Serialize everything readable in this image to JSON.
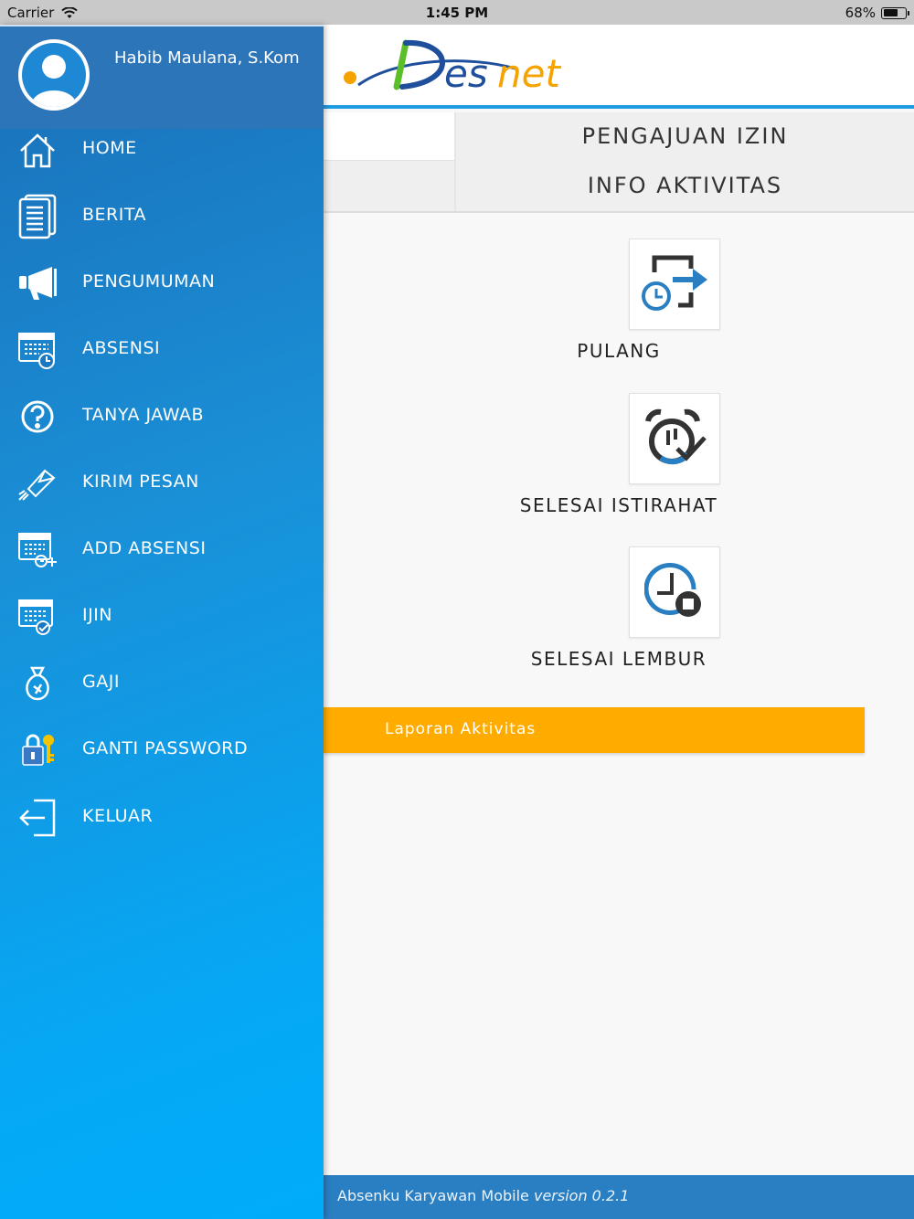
{
  "status_bar": {
    "carrier": "Carrier",
    "time": "1:45 PM",
    "battery": "68%",
    "battery_level": 0.68
  },
  "drawer": {
    "user_name": "Habib Maulana, S.Kom",
    "items": [
      {
        "label": "HOME",
        "icon": "home-icon"
      },
      {
        "label": "BERITA",
        "icon": "news-icon"
      },
      {
        "label": "PENGUMUMAN",
        "icon": "megaphone-icon"
      },
      {
        "label": "ABSENSI",
        "icon": "calendar-clock-icon"
      },
      {
        "label": "TANYA JAWAB",
        "icon": "question-icon"
      },
      {
        "label": "KIRIM PESAN",
        "icon": "send-message-icon"
      },
      {
        "label": "ADD ABSENSI",
        "icon": "calendar-add-icon"
      },
      {
        "label": "IJIN",
        "icon": "calendar-check-icon"
      },
      {
        "label": "GAJI",
        "icon": "money-bag-icon"
      },
      {
        "label": "GANTI PASSWORD",
        "icon": "lock-key-icon"
      },
      {
        "label": "KELUAR",
        "icon": "logout-icon"
      }
    ]
  },
  "header": {
    "logo_text": "Desnet"
  },
  "tabs": {
    "izin": "PENGAJUAN IZIN",
    "info": "INFO AKTIVITAS"
  },
  "actions": [
    {
      "label": "PULANG",
      "icon": "clock-exit-icon"
    },
    {
      "label": "SELESAI ISTIRAHAT",
      "icon": "alarm-check-icon"
    },
    {
      "label": "SELESAI LEMBUR",
      "icon": "clock-stop-icon"
    }
  ],
  "laporan_button": "Laporan Aktivitas",
  "footer": {
    "app_name": "Absenku Karyawan Mobile",
    "version": "version 0.2.1"
  },
  "colors": {
    "accent": "#1e9be2",
    "drawer_top": "#1a6fb8",
    "drawer_bottom": "#00acf9",
    "laporan": "#ffab00",
    "footer": "#2a7fc3",
    "icon_blue": "#2a7fc3",
    "icon_dark": "#333333"
  }
}
